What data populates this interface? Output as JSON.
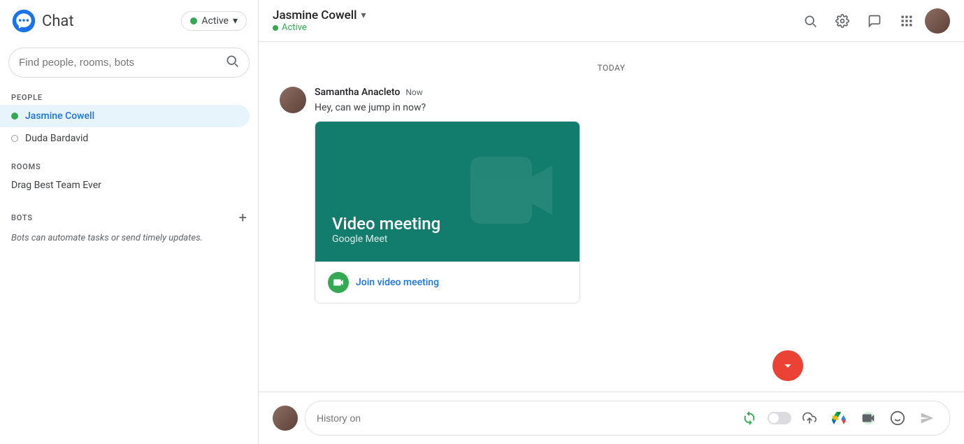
{
  "app": {
    "title": "Chat",
    "status": {
      "label": "Active",
      "color": "#34a853"
    }
  },
  "sidebar": {
    "search": {
      "placeholder": "Find people, rooms, bots"
    },
    "sections": {
      "people": {
        "label": "PEOPLE",
        "items": [
          {
            "name": "Jasmine Cowell",
            "online": true,
            "active": true
          },
          {
            "name": "Duda Bardavid",
            "online": false,
            "active": false
          }
        ]
      },
      "rooms": {
        "label": "ROOMS",
        "items": [
          {
            "name": "Drag Best Team Ever"
          }
        ]
      },
      "bots": {
        "label": "BOTS",
        "description": "Bots can automate tasks or send timely updates."
      }
    }
  },
  "chat": {
    "contact": {
      "name": "Jasmine Cowell",
      "status": "Active"
    },
    "divider": "TODAY",
    "messages": [
      {
        "sender": "Samantha Anacleto",
        "time": "Now",
        "text": "Hey, can we jump in now?",
        "has_video_card": true
      }
    ],
    "video_card": {
      "title": "Video meeting",
      "subtitle": "Google Meet",
      "action": "Join video meeting"
    },
    "input": {
      "placeholder": "History on"
    }
  },
  "icons": {
    "search": "🔍",
    "settings": "⚙",
    "feedback": "💬",
    "apps": "⋮⋮",
    "chevron_down": "▾",
    "plus": "+",
    "history_refresh": "↺",
    "upload": "↑",
    "drive": "△",
    "meet": "📹",
    "emoji": "☺",
    "send": "➤",
    "scroll_down": "↓"
  }
}
